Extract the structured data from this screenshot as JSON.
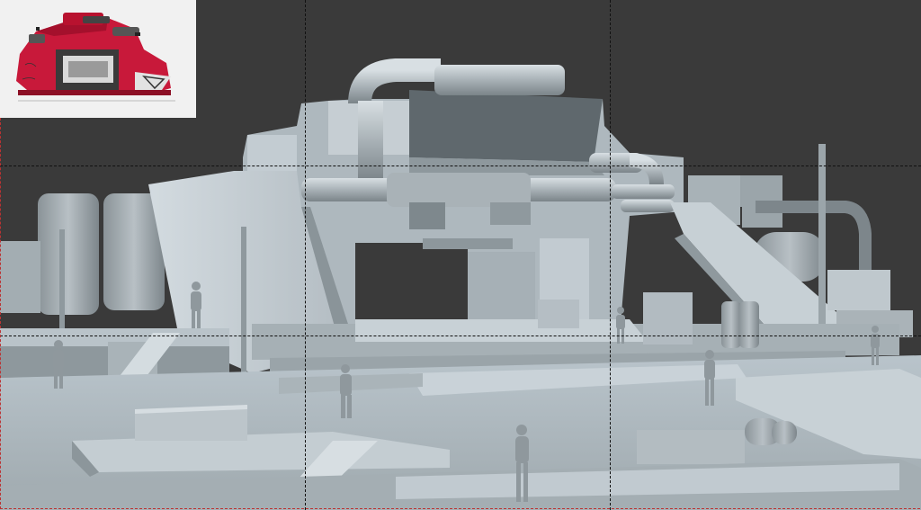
{
  "colors": {
    "background": "#3a3a3a",
    "model_light": "#c9d2d8",
    "model_mid": "#9aa4aa",
    "model_dark": "#6f787e",
    "guide_lines": "#111111",
    "thumb_bg": "#f1f1f1",
    "thumb_accent": "#c8193a"
  },
  "icons": {
    "reference": "vehicle-concept-sketch",
    "figures": "human-scale-figure"
  },
  "guides": {
    "vertical": [
      "third-left",
      "third-right"
    ],
    "horizontal": [
      "third-top",
      "third-bottom"
    ]
  }
}
